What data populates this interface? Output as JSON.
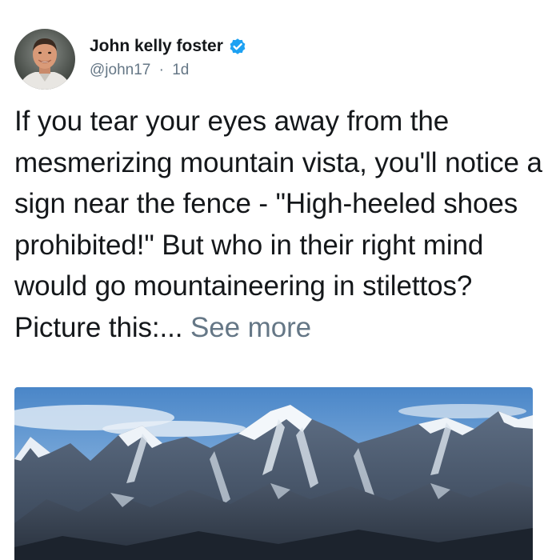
{
  "author": {
    "display_name": "John kelly foster",
    "handle": "@john17",
    "separator": "·",
    "age": "1d",
    "verified": true
  },
  "post": {
    "text": "If you tear your eyes away from the mesmerizing mountain vista, you'll notice a sign near the fence - \"High-heeled shoes prohibited!\" But who in their right mind would go mountaineering in stilettos? Picture this:... ",
    "see_more_label": "See more"
  },
  "icons": {
    "verified": "verified-badge-icon"
  },
  "colors": {
    "text": "#14171a",
    "secondary": "#657786",
    "verified_blue": "#1da1f2",
    "background": "#ffffff"
  }
}
